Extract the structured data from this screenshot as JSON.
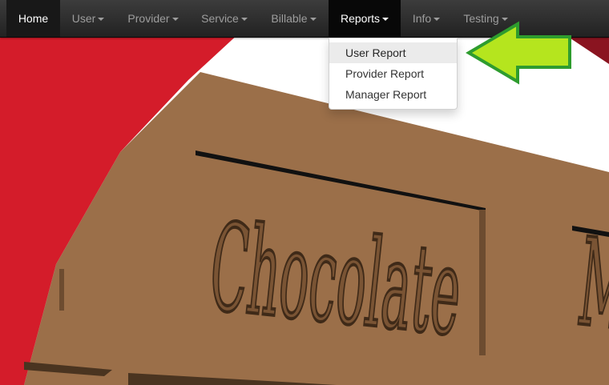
{
  "navbar": {
    "items": [
      {
        "label": "Home",
        "has_caret": false,
        "state": "active"
      },
      {
        "label": "User",
        "has_caret": true
      },
      {
        "label": "Provider",
        "has_caret": true
      },
      {
        "label": "Service",
        "has_caret": true
      },
      {
        "label": "Billable",
        "has_caret": true
      },
      {
        "label": "Reports",
        "has_caret": true,
        "state": "open"
      },
      {
        "label": "Info",
        "has_caret": true
      },
      {
        "label": "Testing",
        "has_caret": true
      }
    ]
  },
  "reports_menu": {
    "items": [
      {
        "label": "User Report",
        "state": "hover"
      },
      {
        "label": "Provider Report"
      },
      {
        "label": "Manager Report"
      }
    ]
  },
  "background": {
    "embossed_text": "Chocolate",
    "colors": {
      "wrapper_red": "#d41c2a",
      "chocolate": "#9b6f49",
      "dark_red": "#8a1420"
    }
  },
  "annotation": {
    "icon": "left-arrow-icon",
    "color": "#b5e51e",
    "outline": "#2e9c2e"
  }
}
